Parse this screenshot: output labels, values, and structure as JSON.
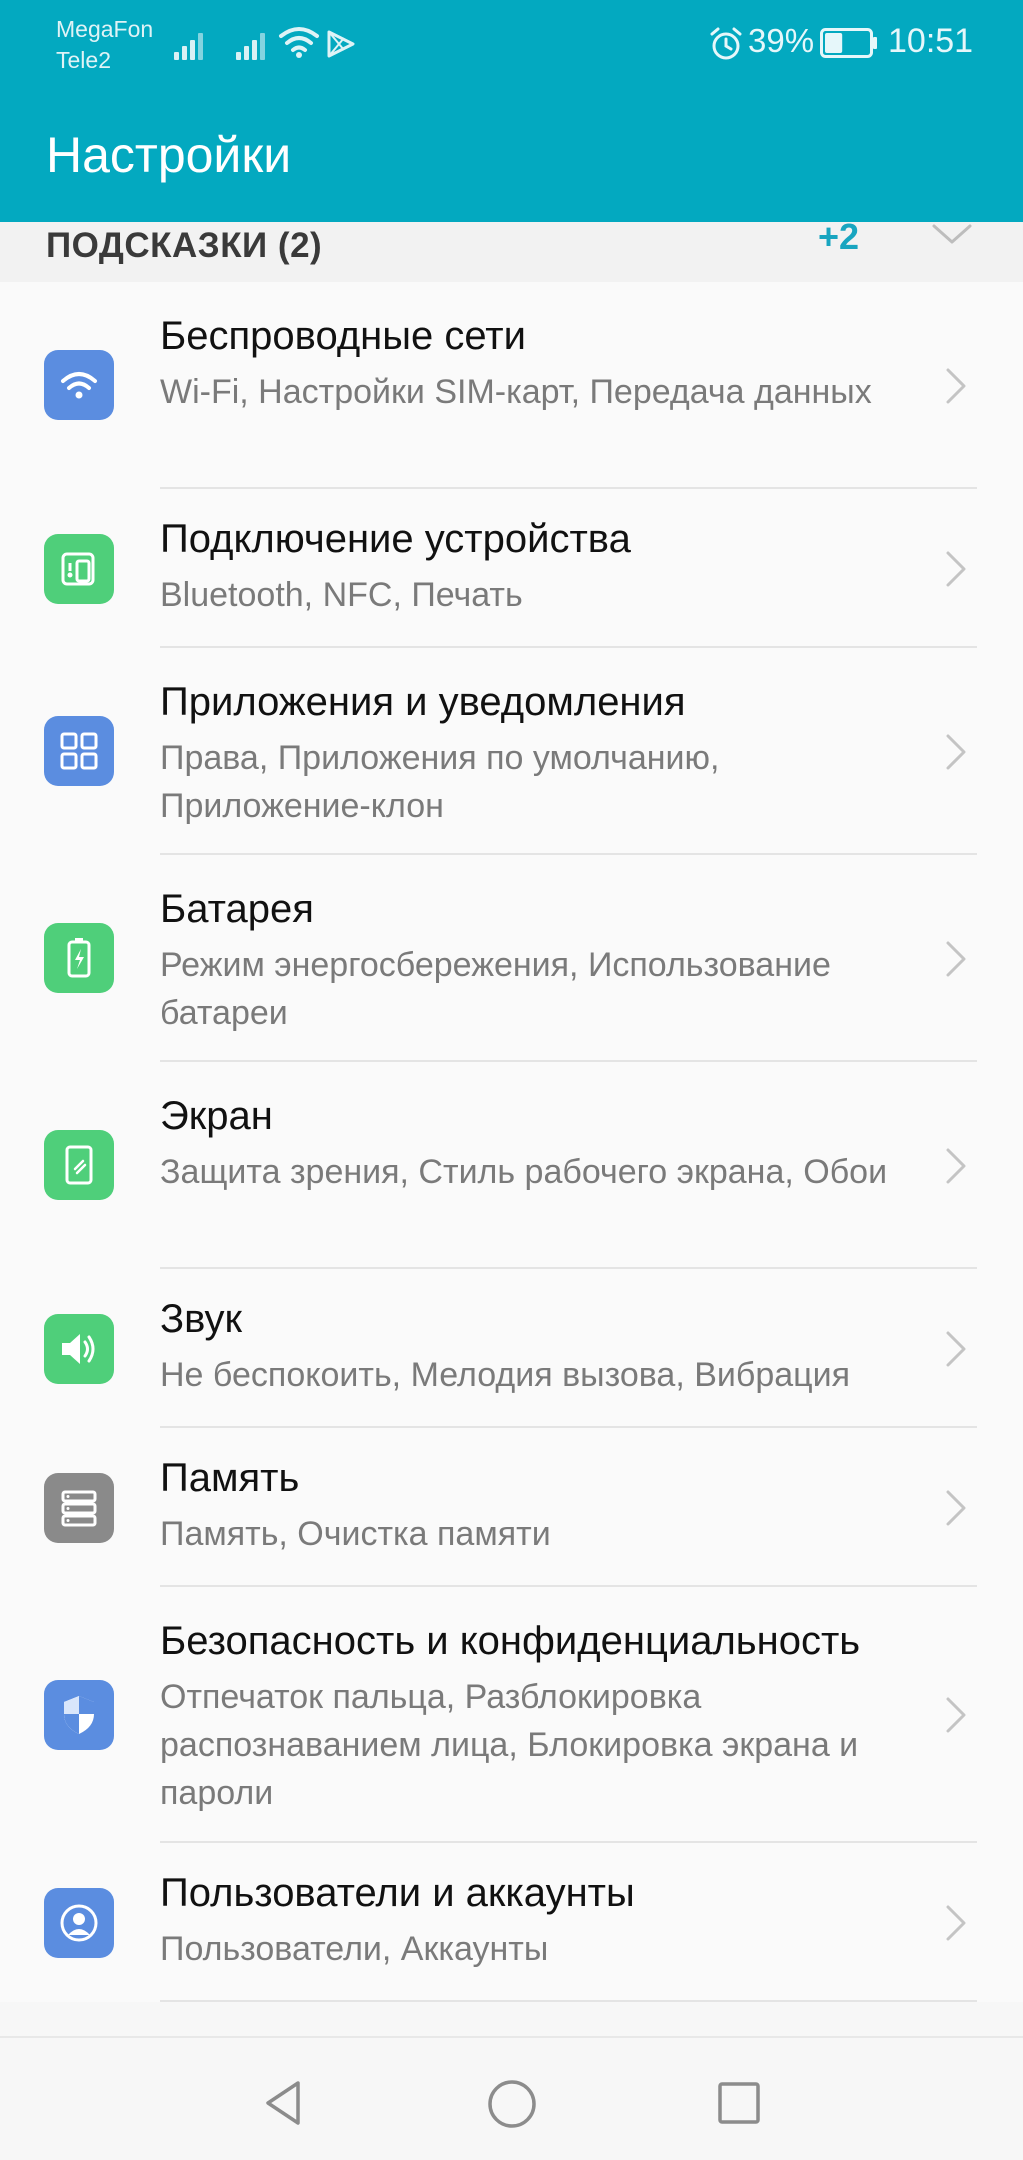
{
  "status_bar": {
    "carrier_1": "MegaFon",
    "carrier_2": "Tele2",
    "battery_percent": "39%",
    "battery_level": 0.39,
    "time": "10:51",
    "icons": [
      "signal-icon",
      "signal-icon",
      "wifi-icon",
      "play-icon",
      "alarm-icon",
      "battery-icon"
    ]
  },
  "app_bar": {
    "title": "Настройки"
  },
  "tips": {
    "label": "ПОДСКАЗКИ (2)",
    "count": "+2"
  },
  "settings": [
    {
      "title": "Беспроводные сети",
      "subtitle": "Wi-Fi, Настройки SIM-карт, Передача данных",
      "icon": "wifi-icon",
      "color": "#5b8de0"
    },
    {
      "title": "Подключение устройства",
      "subtitle": "Bluetooth, NFC, Печать",
      "icon": "device-connection-icon",
      "color": "#4fcf7a"
    },
    {
      "title": "Приложения и уведомления",
      "subtitle": "Права, Приложения по умолчанию, Приложение-клон",
      "icon": "apps-grid-icon",
      "color": "#5b8de0"
    },
    {
      "title": "Батарея",
      "subtitle": "Режим энергосбережения, Использование батареи",
      "icon": "battery-icon",
      "color": "#4fcf7a"
    },
    {
      "title": "Экран",
      "subtitle": "Защита зрения, Стиль рабочего экрана, Обои",
      "icon": "display-icon",
      "color": "#4fcf7a"
    },
    {
      "title": "Звук",
      "subtitle": "Не беспокоить, Мелодия вызова, Вибрация",
      "icon": "speaker-icon",
      "color": "#4fcf7a"
    },
    {
      "title": "Память",
      "subtitle": "Память, Очистка памяти",
      "icon": "storage-icon",
      "color": "#8a8a8a"
    },
    {
      "title": "Безопасность и конфиденциальность",
      "subtitle": "Отпечаток пальца, Разблокировка распознаванием лица, Блокировка экрана и пароли",
      "icon": "shield-icon",
      "color": "#5b8de0"
    },
    {
      "title": "Пользователи и аккаунты",
      "subtitle": "Пользователи, Аккаунты",
      "icon": "user-icon",
      "color": "#5b8de0"
    }
  ],
  "nav_bar": {
    "icons": [
      "back-icon",
      "home-icon",
      "recent-apps-icon"
    ]
  }
}
